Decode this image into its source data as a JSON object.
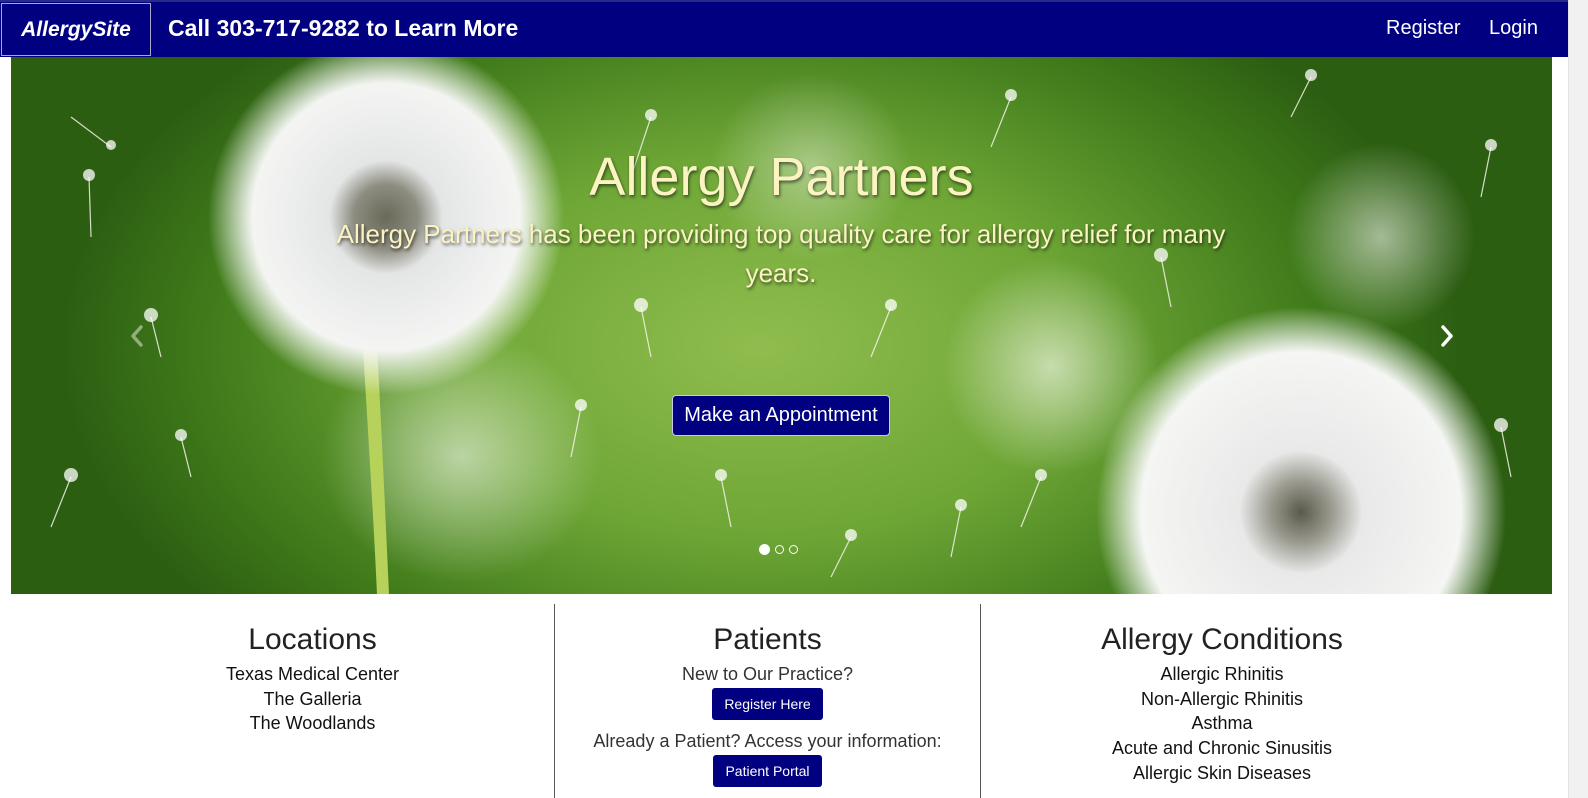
{
  "navbar": {
    "brand": "AllergySite",
    "phone_text": "Call 303-717-9282 to Learn More",
    "links": [
      {
        "label": "Register"
      },
      {
        "label": "Login"
      }
    ]
  },
  "hero": {
    "title": "Allergy Partners",
    "subtitle": "Allergy Partners has been providing top quality care for allergy relief for many years.",
    "cta_label": "Make an Appointment",
    "prev_icon": "chevron-left-icon",
    "next_icon": "chevron-right-icon",
    "slide_count": 3,
    "active_slide": 1
  },
  "locations": {
    "heading": "Locations",
    "items": [
      "Texas Medical Center",
      "The Galleria",
      "The Woodlands"
    ]
  },
  "patients": {
    "heading": "Patients",
    "new_prompt": "New to Our Practice?",
    "register_button": "Register Here",
    "existing_prompt": "Already a Patient? Access your information:",
    "portal_button": "Patient Portal"
  },
  "conditions": {
    "heading": "Allergy Conditions",
    "items": [
      "Allergic Rhinitis",
      "Non-Allergic Rhinitis",
      "Asthma",
      "Acute and Chronic Sinusitis",
      "Allergic Skin Diseases"
    ]
  },
  "colors": {
    "navbar_bg": "#000080",
    "hero_text": "#fbf3c2",
    "button_bg": "#000080"
  }
}
